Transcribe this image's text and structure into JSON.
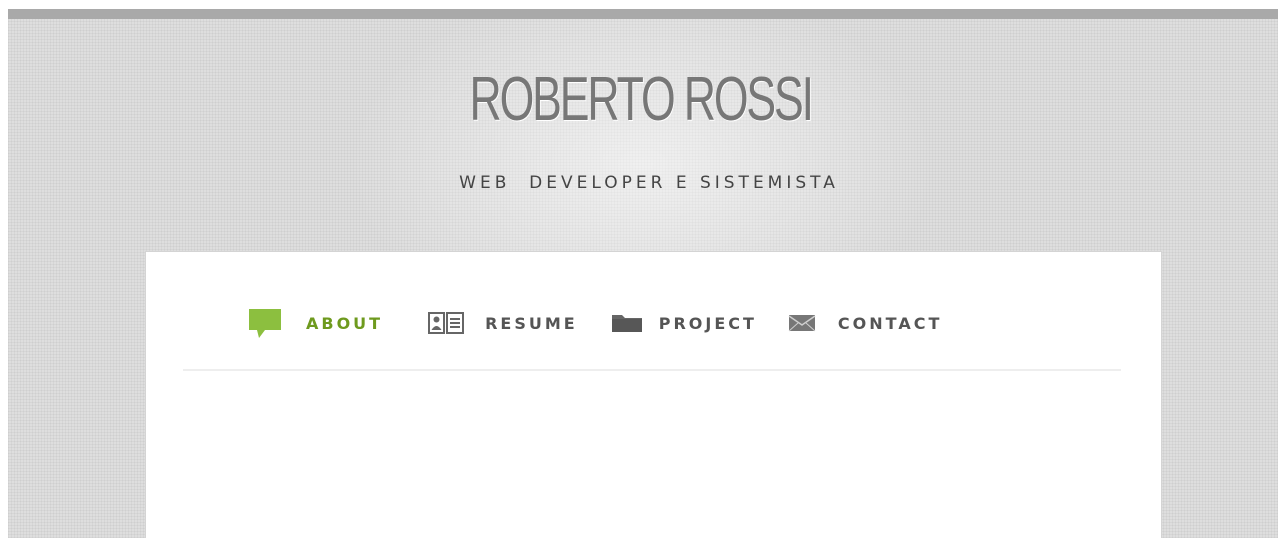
{
  "header": {
    "title": "ROBERTO ROSSI",
    "tagline": "WEB  DEVELOPER E SISTEMISTA"
  },
  "nav": {
    "items": [
      {
        "label": "ABOUT",
        "icon": "speech-bubble-icon",
        "active": true
      },
      {
        "label": "RESUME",
        "icon": "id-card-icon",
        "active": false
      },
      {
        "label": "PROJECT",
        "icon": "folder-icon",
        "active": false
      },
      {
        "label": "CONTACT",
        "icon": "envelope-icon",
        "active": false
      }
    ]
  },
  "colors": {
    "accent": "#6e9a1e",
    "icon_active": "#8cbf3f",
    "nav_text": "#555555",
    "title": "#777777",
    "background": "#dedede",
    "top_bar": "#a9a9a9"
  }
}
